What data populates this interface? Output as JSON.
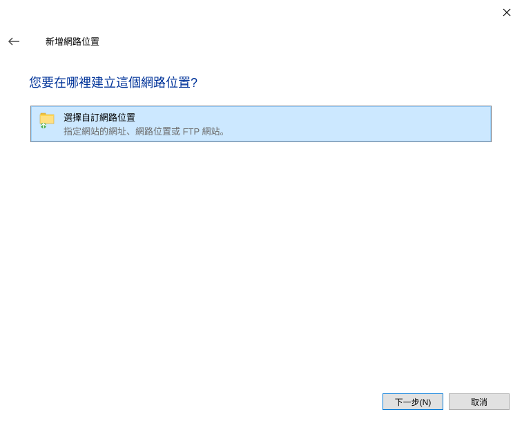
{
  "window": {
    "title": "新增網路位置"
  },
  "heading": "您要在哪裡建立這個網路位置?",
  "option": {
    "title": "選擇自訂網路位置",
    "description": "指定網站的網址、網路位置或 FTP 網站。"
  },
  "buttons": {
    "next": "下一步(N)",
    "cancel": "取消"
  }
}
